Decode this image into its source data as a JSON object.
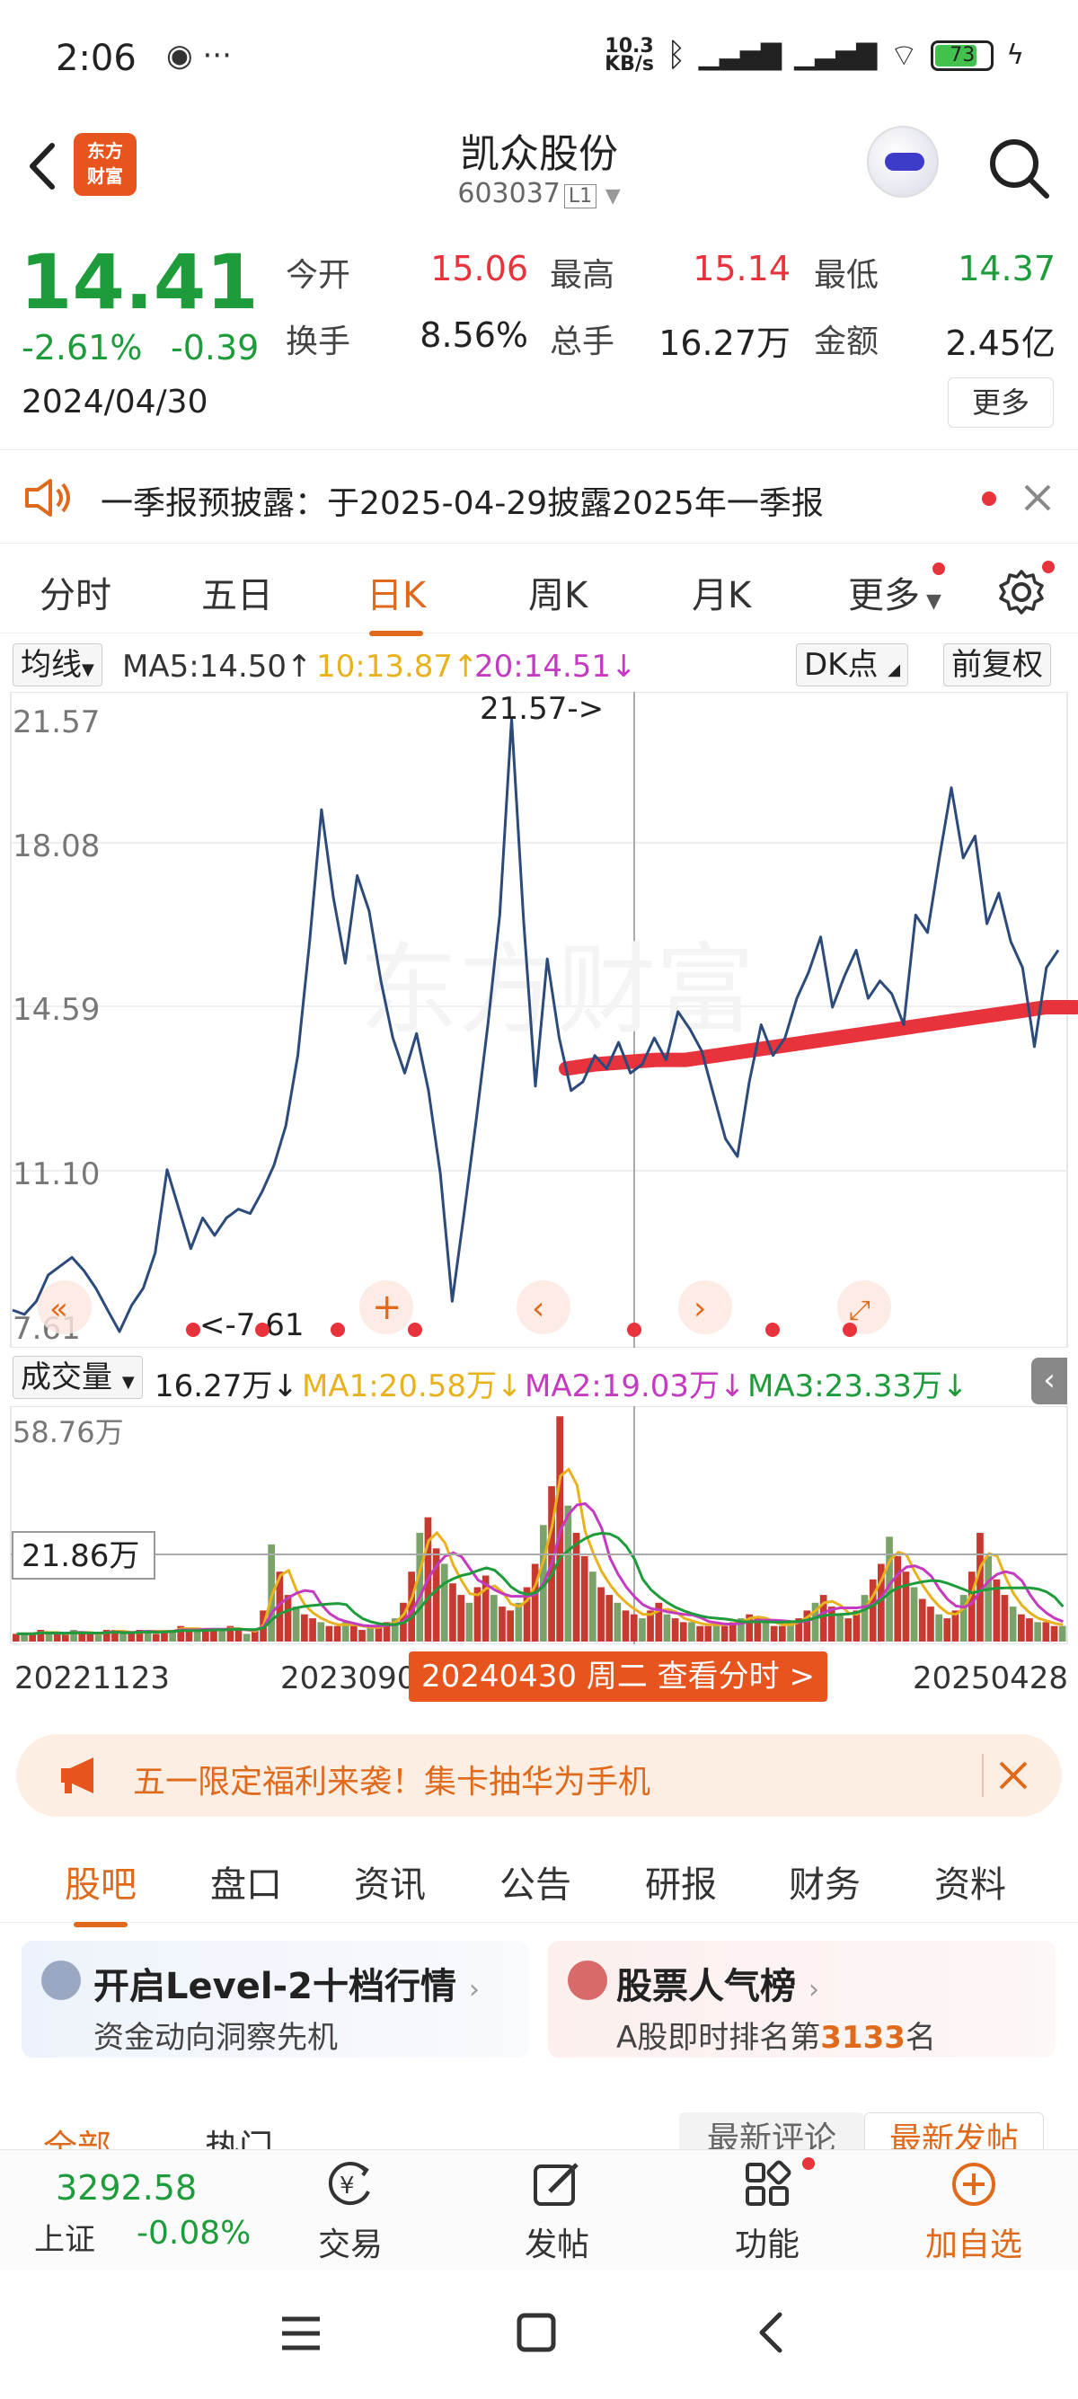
{
  "status_bar": {
    "time": "2:06",
    "net_speed_top": "10.3",
    "net_speed_bottom": "KB/s",
    "battery": "73"
  },
  "header": {
    "logo_text": "东方财富",
    "stock_name": "凯众股份",
    "stock_code": "603037",
    "level_badge": "L1"
  },
  "quote": {
    "price": "14.41",
    "change_pct": "-2.61%",
    "change_amt": "-0.39",
    "date": "2024/04/30",
    "open_label": "今开",
    "open": "15.06",
    "high_label": "最高",
    "high": "15.14",
    "low_label": "最低",
    "low": "14.37",
    "turnover_label": "换手",
    "turnover": "8.56%",
    "volume_label": "总手",
    "volume": "16.27万",
    "amount_label": "金额",
    "amount": "2.45亿",
    "more_label": "更多"
  },
  "notice": {
    "text": "一季报预披露：于2025-04-29披露2025年一季报"
  },
  "period_tabs": [
    "分时",
    "五日",
    "日K",
    "周K",
    "月K",
    "更多"
  ],
  "active_period": 2,
  "ma_row": {
    "type": "均线",
    "ma5": "MA5:14.50",
    "ma10": "10:13.87",
    "ma20": "20:14.51",
    "dk": "DK点",
    "adjust": "前复权"
  },
  "kchart": {
    "y_labels": [
      "21.57",
      "18.08",
      "14.59",
      "11.10",
      "7.61"
    ],
    "max_marker": "21.57->",
    "min_marker": "<-7.61"
  },
  "volume_row": {
    "type": "成交量",
    "vol": "16.27万",
    "ma1": "MA1:20.58万",
    "ma2": "MA2:19.03万",
    "ma3": "MA3:23.33万"
  },
  "volchart": {
    "top_label": "58.76万",
    "cursor_label": "21.86万"
  },
  "x_axis": {
    "start": "20221123",
    "mid": "2023090",
    "end": "20250428",
    "badge": "20240430 周二 查看分时 >"
  },
  "promo": {
    "text": "五一限定福利来袭！集卡抽华为手机"
  },
  "bottom_tabs": [
    "股吧",
    "盘口",
    "资讯",
    "公告",
    "研报",
    "财务",
    "资料"
  ],
  "cards": [
    {
      "title": "开启Level-2十档行情",
      "subtitle": "资金动向洞察先机"
    },
    {
      "title": "股票人气榜",
      "subtitle_pre": "A股即时排名第",
      "rank": "3133",
      "subtitle_post": "名"
    }
  ],
  "filter": {
    "all": "全部",
    "hot": "热门",
    "latest_comment": "最新评论",
    "latest_post": "最新发帖"
  },
  "bottom_nav": {
    "index_value": "3292.58",
    "index_name": "上证",
    "index_change": "-0.08%",
    "trade": "交易",
    "post": "发帖",
    "function": "功能",
    "add": "加自选"
  },
  "chart_data": {
    "type": "line",
    "title": "",
    "x_range": [
      "20221123",
      "20250428"
    ],
    "ylim": [
      7.61,
      21.57
    ],
    "series": [
      {
        "name": "",
        "values": [
          8.1,
          8.0,
          8.3,
          8.9,
          9.1,
          9.3,
          9.0,
          8.6,
          8.1,
          7.61,
          8.2,
          8.6,
          9.4,
          11.3,
          10.4,
          9.5,
          10.2,
          9.8,
          10.2,
          10.4,
          10.3,
          10.8,
          11.4,
          12.3,
          13.9,
          16.5,
          19.5,
          17.5,
          16.0,
          18.0,
          17.2,
          15.6,
          14.3,
          13.5,
          14.4,
          13.1,
          11.2,
          8.3,
          10.3,
          12.4,
          14.6,
          17.1,
          21.57,
          17.0,
          13.2,
          16.1,
          14.3,
          13.1,
          13.3,
          13.9,
          13.6,
          14.2,
          13.5,
          13.7,
          14.3,
          13.8,
          14.9,
          14.5,
          14.0,
          13.0,
          12.0,
          11.6,
          13.3,
          14.6,
          13.9,
          14.3,
          15.2,
          15.8,
          16.6,
          15.0,
          15.7,
          16.3,
          15.2,
          15.6,
          15.3,
          14.6,
          17.1,
          16.7,
          18.4,
          20.0,
          18.4,
          18.9,
          16.9,
          17.6,
          16.5,
          15.9,
          14.1,
          15.9,
          16.3
        ]
      },
      {
        "name": "",
        "values": [
          13.6,
          13.7,
          13.75,
          13.8,
          13.8,
          13.9,
          14.0,
          14.1,
          14.2,
          14.3,
          14.4,
          14.5,
          14.6,
          14.7,
          14.8,
          14.9,
          15.0,
          15.0
        ]
      }
    ]
  },
  "volume_data": {
    "type": "bar",
    "ylim": [
      0,
      58.76
    ],
    "values": [
      2,
      2,
      2,
      3,
      2,
      2,
      2,
      3,
      2,
      2,
      2,
      3,
      3,
      2,
      2,
      3,
      3,
      2,
      3,
      3,
      4,
      3,
      3,
      3,
      3,
      3,
      4,
      3,
      2,
      3,
      8,
      25,
      18,
      12,
      9,
      7,
      6,
      5,
      4,
      4,
      5,
      4,
      3,
      4,
      4,
      5,
      6,
      10,
      18,
      28,
      32,
      24,
      20,
      15,
      12,
      10,
      14,
      17,
      12,
      9,
      8,
      10,
      14,
      20,
      30,
      40,
      58,
      35,
      28,
      22,
      18,
      14,
      12,
      10,
      8,
      7,
      6,
      8,
      10,
      7,
      6,
      5,
      5,
      4,
      4,
      5,
      4,
      5,
      6,
      7,
      6,
      5,
      4,
      4,
      5,
      6,
      8,
      10,
      12,
      9,
      7,
      6,
      8,
      12,
      16,
      20,
      27,
      22,
      18,
      14,
      11,
      9,
      7,
      6,
      8,
      12,
      18,
      28,
      22,
      16,
      12,
      9,
      7,
      6,
      5,
      5,
      4,
      4
    ]
  }
}
